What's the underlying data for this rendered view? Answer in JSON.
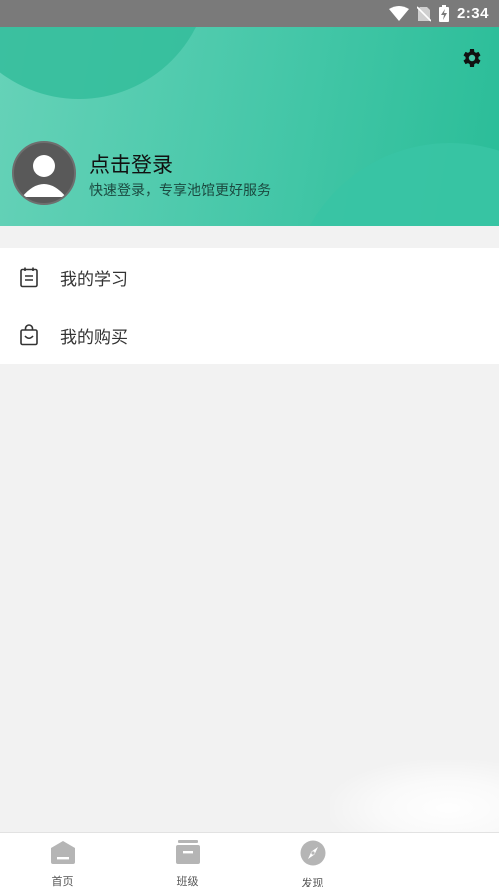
{
  "status_bar": {
    "time": "2:34",
    "icons": [
      "wifi-icon",
      "no-sim-icon",
      "battery-charging-icon"
    ]
  },
  "header": {
    "settings_icon": "gear-icon",
    "avatar_icon": "default-avatar-icon",
    "title": "点击登录",
    "subtitle": "快速登录，专享池馆更好服务",
    "colors": {
      "gradient_start": "#66d2b8",
      "gradient_end": "#2abd98"
    }
  },
  "menu": {
    "items": [
      {
        "label": "我的学习",
        "icon": "calendar-list-icon"
      },
      {
        "label": "我的购买",
        "icon": "shopping-bag-icon"
      }
    ]
  },
  "tabbar": {
    "tabs": [
      {
        "label": "首页",
        "icon": "home-icon"
      },
      {
        "label": "班级",
        "icon": "class-box-icon"
      },
      {
        "label": "发现",
        "icon": "compass-icon"
      }
    ]
  }
}
